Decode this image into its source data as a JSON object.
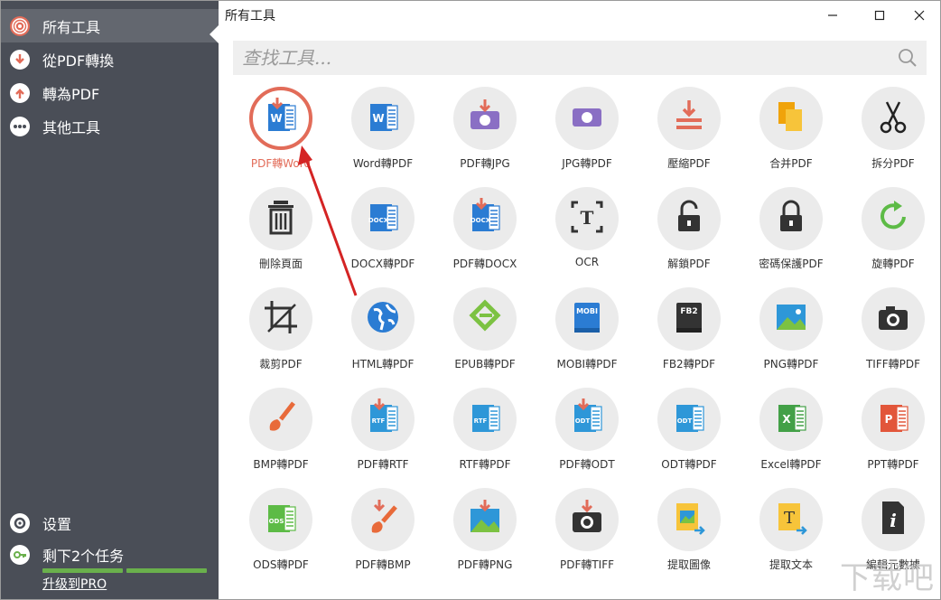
{
  "sidebar": {
    "items": [
      {
        "label": "所有工具",
        "icon": "all-tools-icon",
        "active": true
      },
      {
        "label": "從PDF轉換",
        "icon": "from-pdf-icon",
        "active": false
      },
      {
        "label": "轉為PDF",
        "icon": "to-pdf-icon",
        "active": false
      },
      {
        "label": "其他工具",
        "icon": "more-tools-icon",
        "active": false
      }
    ],
    "settings_label": "设置",
    "tasks_label": "剩下2个任务",
    "upgrade_label": "升级到PRO"
  },
  "window": {
    "title": "所有工具",
    "minimize_symbol": "—",
    "maximize_symbol": "☐",
    "close_symbol": "✕"
  },
  "search": {
    "placeholder": "查找工具..."
  },
  "tools": [
    {
      "label": "PDF轉Word",
      "icon": "pdf-to-word-icon",
      "active": true
    },
    {
      "label": "Word轉PDF",
      "icon": "word-to-pdf-icon"
    },
    {
      "label": "PDF轉JPG",
      "icon": "pdf-to-jpg-icon"
    },
    {
      "label": "JPG轉PDF",
      "icon": "jpg-to-pdf-icon"
    },
    {
      "label": "壓縮PDF",
      "icon": "compress-pdf-icon"
    },
    {
      "label": "合并PDF",
      "icon": "merge-pdf-icon"
    },
    {
      "label": "拆分PDF",
      "icon": "split-pdf-icon"
    },
    {
      "label": "刪除頁面",
      "icon": "delete-pages-icon"
    },
    {
      "label": "DOCX轉PDF",
      "icon": "docx-to-pdf-icon"
    },
    {
      "label": "PDF轉DOCX",
      "icon": "pdf-to-docx-icon"
    },
    {
      "label": "OCR",
      "icon": "ocr-icon"
    },
    {
      "label": "解鎖PDF",
      "icon": "unlock-pdf-icon"
    },
    {
      "label": "密碼保護PDF",
      "icon": "protect-pdf-icon"
    },
    {
      "label": "旋轉PDF",
      "icon": "rotate-pdf-icon"
    },
    {
      "label": "裁剪PDF",
      "icon": "crop-pdf-icon"
    },
    {
      "label": "HTML轉PDF",
      "icon": "html-to-pdf-icon"
    },
    {
      "label": "EPUB轉PDF",
      "icon": "epub-to-pdf-icon"
    },
    {
      "label": "MOBI轉PDF",
      "icon": "mobi-to-pdf-icon"
    },
    {
      "label": "FB2轉PDF",
      "icon": "fb2-to-pdf-icon"
    },
    {
      "label": "PNG轉PDF",
      "icon": "png-to-pdf-icon"
    },
    {
      "label": "TIFF轉PDF",
      "icon": "tiff-to-pdf-icon"
    },
    {
      "label": "BMP轉PDF",
      "icon": "bmp-to-pdf-icon"
    },
    {
      "label": "PDF轉RTF",
      "icon": "pdf-to-rtf-icon"
    },
    {
      "label": "RTF轉PDF",
      "icon": "rtf-to-pdf-icon"
    },
    {
      "label": "PDF轉ODT",
      "icon": "pdf-to-odt-icon"
    },
    {
      "label": "ODT轉PDF",
      "icon": "odt-to-pdf-icon"
    },
    {
      "label": "Excel轉PDF",
      "icon": "excel-to-pdf-icon"
    },
    {
      "label": "PPT轉PDF",
      "icon": "ppt-to-pdf-icon"
    },
    {
      "label": "ODS轉PDF",
      "icon": "ods-to-pdf-icon"
    },
    {
      "label": "PDF轉BMP",
      "icon": "pdf-to-bmp-icon"
    },
    {
      "label": "PDF轉PNG",
      "icon": "pdf-to-png-icon"
    },
    {
      "label": "PDF轉TIFF",
      "icon": "pdf-to-tiff-icon"
    },
    {
      "label": "提取圖像",
      "icon": "extract-images-icon"
    },
    {
      "label": "提取文本",
      "icon": "extract-text-icon"
    },
    {
      "label": "編輯元數據",
      "icon": "edit-metadata-icon"
    }
  ],
  "icon_text": {
    "docx": "DOCX",
    "rtf": "RTF",
    "odt": "ODT",
    "mobi": "MOBI",
    "fb2": "FB2",
    "ods": "ODS",
    "word": "W",
    "excel": "X",
    "ppt": "P",
    "ocr": "T",
    "text": "T",
    "meta": "i"
  },
  "watermark": "下载吧",
  "colors": {
    "sidebar_bg": "#4a4e57",
    "sidebar_active": "#63676f",
    "accent_red": "#e26c59",
    "word_blue": "#2b7cd3",
    "progress_green": "#6ab04c",
    "tool_circle": "#ebebeb"
  }
}
